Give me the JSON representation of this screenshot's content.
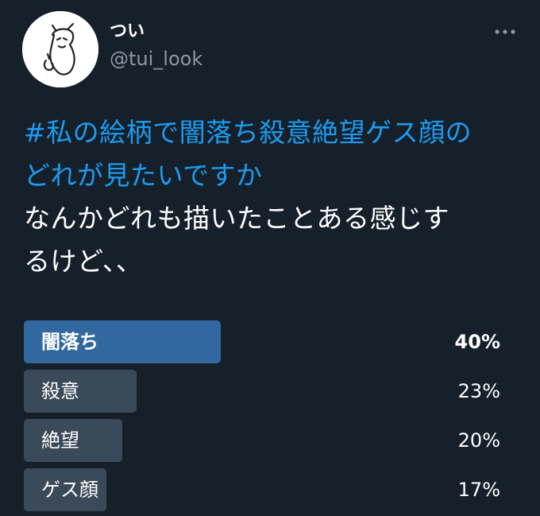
{
  "user": {
    "display_name": "つい",
    "handle": "@tui_look",
    "avatar_icon": "sketch-character-avatar"
  },
  "tweet": {
    "hashtag_line1": "#私の絵柄で闇落ち殺意絶望ゲス顔の",
    "hashtag_line2": "どれが見たいですか",
    "body_line1": "なんかどれも描いたことある感じす",
    "body_line2": "るけど、、"
  },
  "poll": {
    "options": [
      {
        "label": "闇落ち",
        "percent_text": "40%",
        "percent": 40,
        "winner": true
      },
      {
        "label": "殺意",
        "percent_text": "23%",
        "percent": 23,
        "winner": false
      },
      {
        "label": "絶望",
        "percent_text": "20%",
        "percent": 20,
        "winner": false
      },
      {
        "label": "ゲス顔",
        "percent_text": "17%",
        "percent": 17,
        "winner": false
      }
    ]
  },
  "colors": {
    "background": "#15202b",
    "hashtag": "#1d9bf0",
    "winner_bar": "#31689f",
    "bar": "#3b4a59",
    "secondary_text": "#8b98a5"
  },
  "icons": {
    "more": "more-options-icon"
  }
}
